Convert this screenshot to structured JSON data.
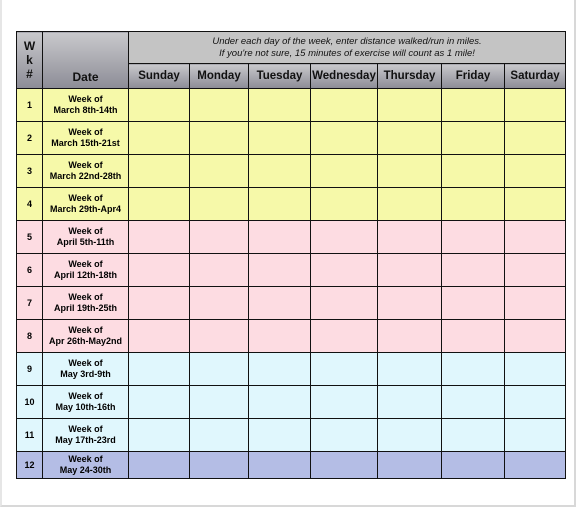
{
  "header": {
    "wk_label": [
      "W",
      "k",
      "#"
    ],
    "date_label": "Date",
    "note_line1": "Under each day of the week, enter distance walked/run in miles.",
    "note_line2": "If you're not sure, 15 minutes of exercise will count as 1 mile!",
    "days": [
      "Sunday",
      "Monday",
      "Tuesday",
      "Wednesday",
      "Thursday",
      "Friday",
      "Saturday"
    ]
  },
  "colors": {
    "march": "#f6f9a9",
    "april": "#fddce2",
    "may": "#e0f7fd",
    "last": "#b4bde5"
  },
  "rows": [
    {
      "wk": "1",
      "line1": "Week of",
      "line2": "March 8th-14th",
      "group": "march"
    },
    {
      "wk": "2",
      "line1": "Week of",
      "line2": "March 15th-21st",
      "group": "march"
    },
    {
      "wk": "3",
      "line1": "Week of",
      "line2": "March 22nd-28th",
      "group": "march"
    },
    {
      "wk": "4",
      "line1": "Week of",
      "line2": "March 29th-Apr4",
      "group": "march"
    },
    {
      "wk": "5",
      "line1": "Week of",
      "line2": "April 5th-11th",
      "group": "april"
    },
    {
      "wk": "6",
      "line1": "Week of",
      "line2": "April 12th-18th",
      "group": "april"
    },
    {
      "wk": "7",
      "line1": "Week of",
      "line2": "April 19th-25th",
      "group": "april"
    },
    {
      "wk": "8",
      "line1": "Week of",
      "line2": "Apr 26th-May2nd",
      "group": "april"
    },
    {
      "wk": "9",
      "line1": "Week of",
      "line2": "May 3rd-9th",
      "group": "may"
    },
    {
      "wk": "10",
      "line1": "Week of",
      "line2": "May 10th-16th",
      "group": "may"
    },
    {
      "wk": "11",
      "line1": "Week of",
      "line2": "May 17th-23rd",
      "group": "may"
    },
    {
      "wk": "12",
      "line1": "Week of",
      "line2": "May 24-30th",
      "group": "last"
    }
  ]
}
